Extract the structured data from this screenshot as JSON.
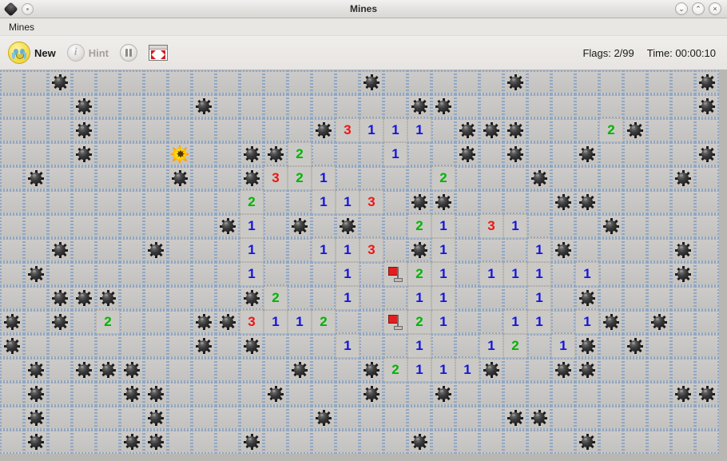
{
  "window": {
    "title": "Mines",
    "app_icon": "mine-icon",
    "menu_label": "Mines",
    "buttons": [
      {
        "name": "minimize-button",
        "glyph": "⌄"
      },
      {
        "name": "maximize-button",
        "glyph": "⌃"
      },
      {
        "name": "close-button",
        "glyph": "×"
      }
    ]
  },
  "toolbar": {
    "new_label": "New",
    "new_icon": "crying-face-icon",
    "hint_label": "Hint",
    "hint_icon": "info-icon",
    "pause_icon": "pause-icon",
    "fullscreen_icon": "fullscreen-icon",
    "flags_label": "Flags: 2/99",
    "time_label": "Time: 00:00:10"
  },
  "colors": {
    "n1": "#1414dc",
    "n2": "#00b400",
    "n3": "#ef1414",
    "flag_red": "#e02020",
    "hidden_border": "#8fa7c4",
    "cell_face": "#cbc9c6"
  },
  "board": {
    "cols": 30,
    "rows": 16,
    "cell_size": 30,
    "legend": {
      "0": "hidden-empty",
      "M": "hidden-mine",
      "F": "flag",
      "X": "exploded-mine",
      ".": "open-blank",
      "1": "open-1",
      "2": "open-2",
      "3": "open-3"
    },
    "cells": [
      "00M000000000000M00000M0000000MM",
      "000M0000M00000000MM0000000000MM",
      "000M000000000M31110MMM0002M0000",
      "000M000M00MM2000100M0M00M0000M0",
      "0M00000M00M32100002000M00000M00",
      "00000000002001130MM0000MM000000",
      "000000000M10M0M0021031000M00000",
      "00M000M0001001130M10001M0000M00",
      "0M00000000100010F21011101000M00",
      "00MMM00000M2001001100010M000000",
      "M0M02000MM311200F21001101M0M000",
      "M0000000M0M0001001001201M0M0002",
      "0M0MMM000000M00M2111M00MM000000",
      "0M000MM0000M000M00M000000000MM0",
      "0M0000M000000M0000000MM00000000",
      "0M000MM000M000000M000000M000000M"
    ]
  }
}
